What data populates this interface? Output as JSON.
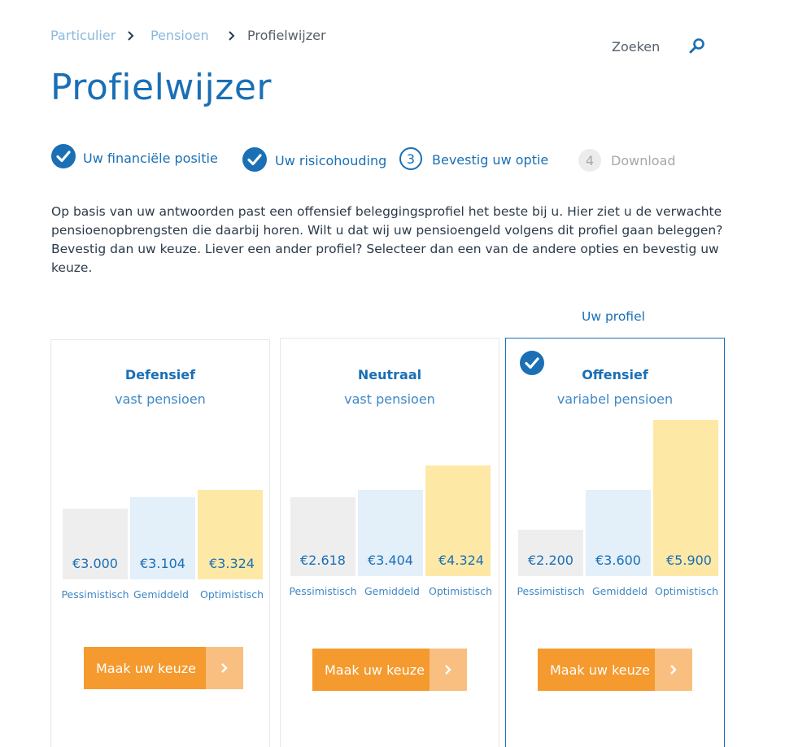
{
  "breadcrumb": {
    "items": [
      {
        "label": "Particulier"
      },
      {
        "label": "Pensioen"
      },
      {
        "label": "Profielwijzer"
      }
    ]
  },
  "search": {
    "label": "Zoeken",
    "icon": "search-icon"
  },
  "page": {
    "title": "Profielwijzer"
  },
  "steps": [
    {
      "label": "Uw financiële positie",
      "state": "done"
    },
    {
      "label": "Uw risicohouding",
      "state": "done"
    },
    {
      "number": "3",
      "label": "Bevestig uw optie",
      "state": "current"
    },
    {
      "number": "4",
      "label": "Download",
      "state": "upcoming"
    }
  ],
  "intro": "Op basis van uw antwoorden past een offensief beleggingsprofiel het beste bij u. Hier ziet u de verwachte pensioenopbrengsten die daarbij horen. Wilt u dat wij uw pensioengeld volgens dit profiel gaan beleggen? Bevestig dan uw keuze. Liever een ander profiel? Selecteer dan een van de andere opties en bevestig uw keuze.",
  "your_profile_label": "Uw profiel",
  "colors": {
    "primary": "#1a6fb5",
    "orange": "#f59a2e",
    "orange_light": "#f8bf80",
    "bar_pessimistic": "#eeeeee",
    "bar_average": "#e3eff9",
    "bar_optimistic": "#fde8a6"
  },
  "scenario_labels": [
    "Pessimistisch",
    "Gemiddeld",
    "Optimistisch"
  ],
  "cards": [
    {
      "title": "Defensief",
      "subtitle": "vast pensioen",
      "selected": false,
      "values": [
        "€3.000",
        "€3.104",
        "€3.324"
      ],
      "amounts": [
        3000,
        3104,
        3324
      ],
      "button": "Maak uw keuze"
    },
    {
      "title": "Neutraal",
      "subtitle": "vast pensioen",
      "selected": false,
      "values": [
        "€2.618",
        "€3.404",
        "€4.324"
      ],
      "amounts": [
        2618,
        3404,
        4324
      ],
      "button": "Maak uw keuze"
    },
    {
      "title": "Offensief",
      "subtitle": "variabel pensioen",
      "selected": true,
      "values": [
        "€2.200",
        "€3.600",
        "€5.900"
      ],
      "amounts": [
        2200,
        3600,
        5900
      ],
      "button": "Maak uw keuze"
    }
  ]
}
